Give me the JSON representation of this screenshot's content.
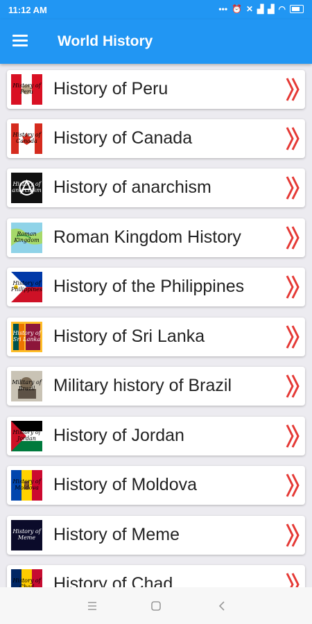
{
  "status": {
    "time": "11:12 AM"
  },
  "app": {
    "title": "World History"
  },
  "items": [
    {
      "label": "History of Peru",
      "flag": "peru",
      "thumb_text": "History of Peru"
    },
    {
      "label": "History of Canada",
      "flag": "canada",
      "thumb_text": "History of Canada"
    },
    {
      "label": "History of anarchism",
      "flag": "anarchism",
      "thumb_text": "History of anarchism"
    },
    {
      "label": "Roman Kingdom History",
      "flag": "roman",
      "thumb_text": "Roman Kingdom"
    },
    {
      "label": "History of the Philippines",
      "flag": "philippines",
      "thumb_text": "History of Philippines"
    },
    {
      "label": "History of Sri Lanka",
      "flag": "srilanka",
      "thumb_text": "History of Sri Lanka"
    },
    {
      "label": "Military history of Brazil",
      "flag": "brazil",
      "thumb_text": "Military of Brazil"
    },
    {
      "label": "History of Jordan",
      "flag": "jordan",
      "thumb_text": "History of Jordan"
    },
    {
      "label": "History of Moldova",
      "flag": "moldova",
      "thumb_text": "History of Moldova"
    },
    {
      "label": "History of Meme",
      "flag": "meme",
      "thumb_text": "History of Meme"
    },
    {
      "label": "History of Chad",
      "flag": "chad",
      "thumb_text": "History of Chad"
    }
  ],
  "colors": {
    "primary": "#2196f3",
    "chevron": "#e53935",
    "background": "#ecebf0"
  },
  "icons": {
    "menu": "hamburger-icon",
    "chevron": "double-chevron-right-icon",
    "nav_recents": "recents-icon",
    "nav_home": "home-icon",
    "nav_back": "back-icon"
  }
}
